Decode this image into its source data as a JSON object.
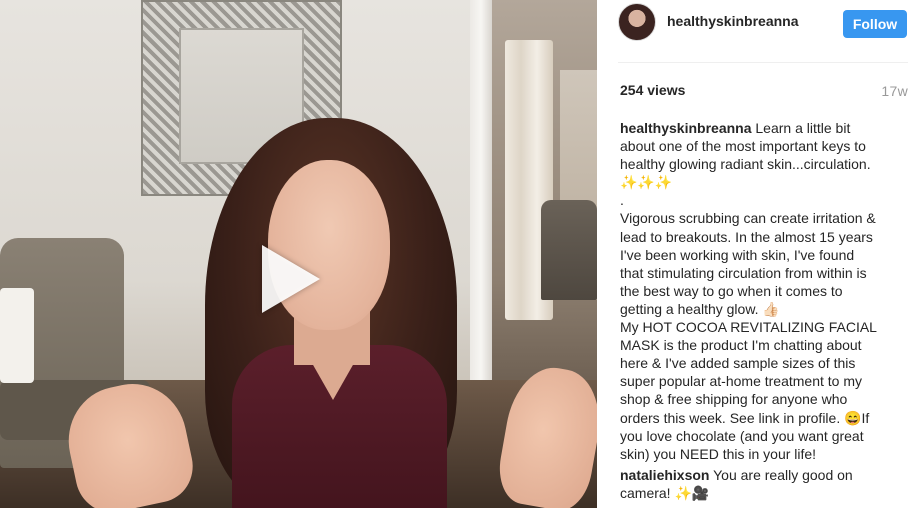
{
  "post": {
    "username": "healthyskinbreanna",
    "follow_label": "Follow",
    "views": "254 views",
    "age": "17w",
    "caption_lines": [
      "Learn a little bit",
      "about one of the most important keys to",
      "healthy glowing radiant skin...circulation.",
      "✨✨✨",
      ".",
      "Vigorous scrubbing can create irritation &",
      "lead to breakouts. In the almost 15 years",
      "I've been working with skin, I've found",
      "that stimulating circulation from within is",
      "the best way to go when it comes to",
      "getting a healthy glow. 👍🏻",
      "My HOT COCOA REVITALIZING FACIAL",
      "MASK is the product I'm chatting about",
      "here & I've added sample sizes of this",
      "super popular at-home treatment to my",
      "shop & free shipping for anyone who",
      "orders this week. See link in profile. 😄If",
      "you love chocolate (and you want great",
      "skin) you NEED this in your life!"
    ]
  },
  "comments": [
    {
      "username": "nataliehixson",
      "lines": [
        "You are really good on",
        "camera! ✨🎥"
      ]
    }
  ],
  "icons": {
    "play": "play-icon",
    "avatar": "avatar"
  },
  "colors": {
    "follow_button": "#3897f0",
    "text": "#262626",
    "muted": "#999999"
  }
}
